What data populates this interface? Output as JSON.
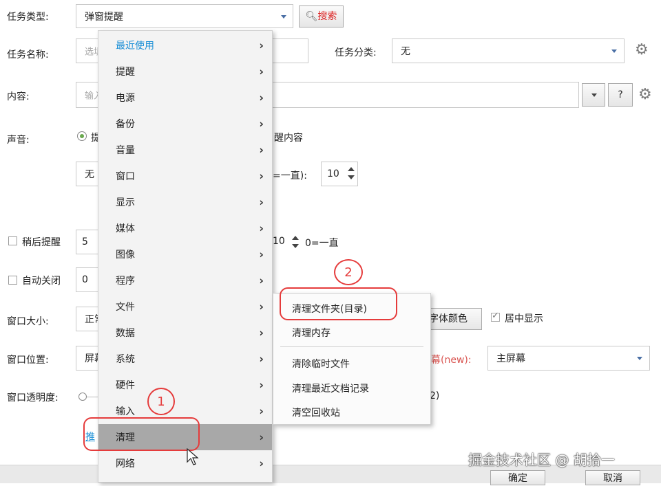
{
  "form": {
    "task_type": {
      "label": "任务类型:",
      "value": "弹窗提醒"
    },
    "search_button": "搜索",
    "task_name": {
      "label": "任务名称:",
      "placeholder": "选填"
    },
    "task_category": {
      "label": "任务分类:",
      "value": "无"
    },
    "content": {
      "label": "内容:",
      "placeholder": "输入",
      "help": "?"
    },
    "sound": {
      "label": "声音:",
      "radio_partial": "提",
      "suffix": "醒内容"
    },
    "sound_select": "无",
    "repeat": {
      "prefix": "=一直):",
      "value": "10"
    },
    "later": {
      "label": "稍后提醒",
      "value": "5",
      "value2": "10",
      "suffix": "0=一直"
    },
    "auto_close": {
      "label": "自动关闭",
      "value": "0"
    },
    "window_size": {
      "label": "窗口大小:",
      "value": "正常",
      "font_color_btn": "字体颜色",
      "center_label": "居中显示"
    },
    "window_pos": {
      "label": "窗口位置:",
      "value": "屏幕",
      "screen_label": "幕(new):",
      "screen_value": "主屏幕"
    },
    "opacity": {
      "label": "窗口透明度:",
      "tail": "2)"
    },
    "link_partial": "推",
    "ok": "确定",
    "cancel": "取消"
  },
  "menu": {
    "items": [
      "最近使用",
      "提醒",
      "电源",
      "备份",
      "音量",
      "窗口",
      "显示",
      "媒体",
      "图像",
      "程序",
      "文件",
      "数据",
      "系统",
      "硬件",
      "输入",
      "清理",
      "网络"
    ],
    "active_index": 15
  },
  "submenu": {
    "items": [
      "清理文件夹(目录)",
      "清理内存",
      "清除临时文件",
      "清理最近文档记录",
      "清空回收站"
    ]
  },
  "annotations": {
    "one": "1",
    "two": "2"
  },
  "watermark": "掘金技术社区 @ 胡拾一",
  "colors": {
    "accent_blue": "#1a8fd6",
    "annotation_red": "#e53b3b",
    "search_red": "#d22"
  }
}
